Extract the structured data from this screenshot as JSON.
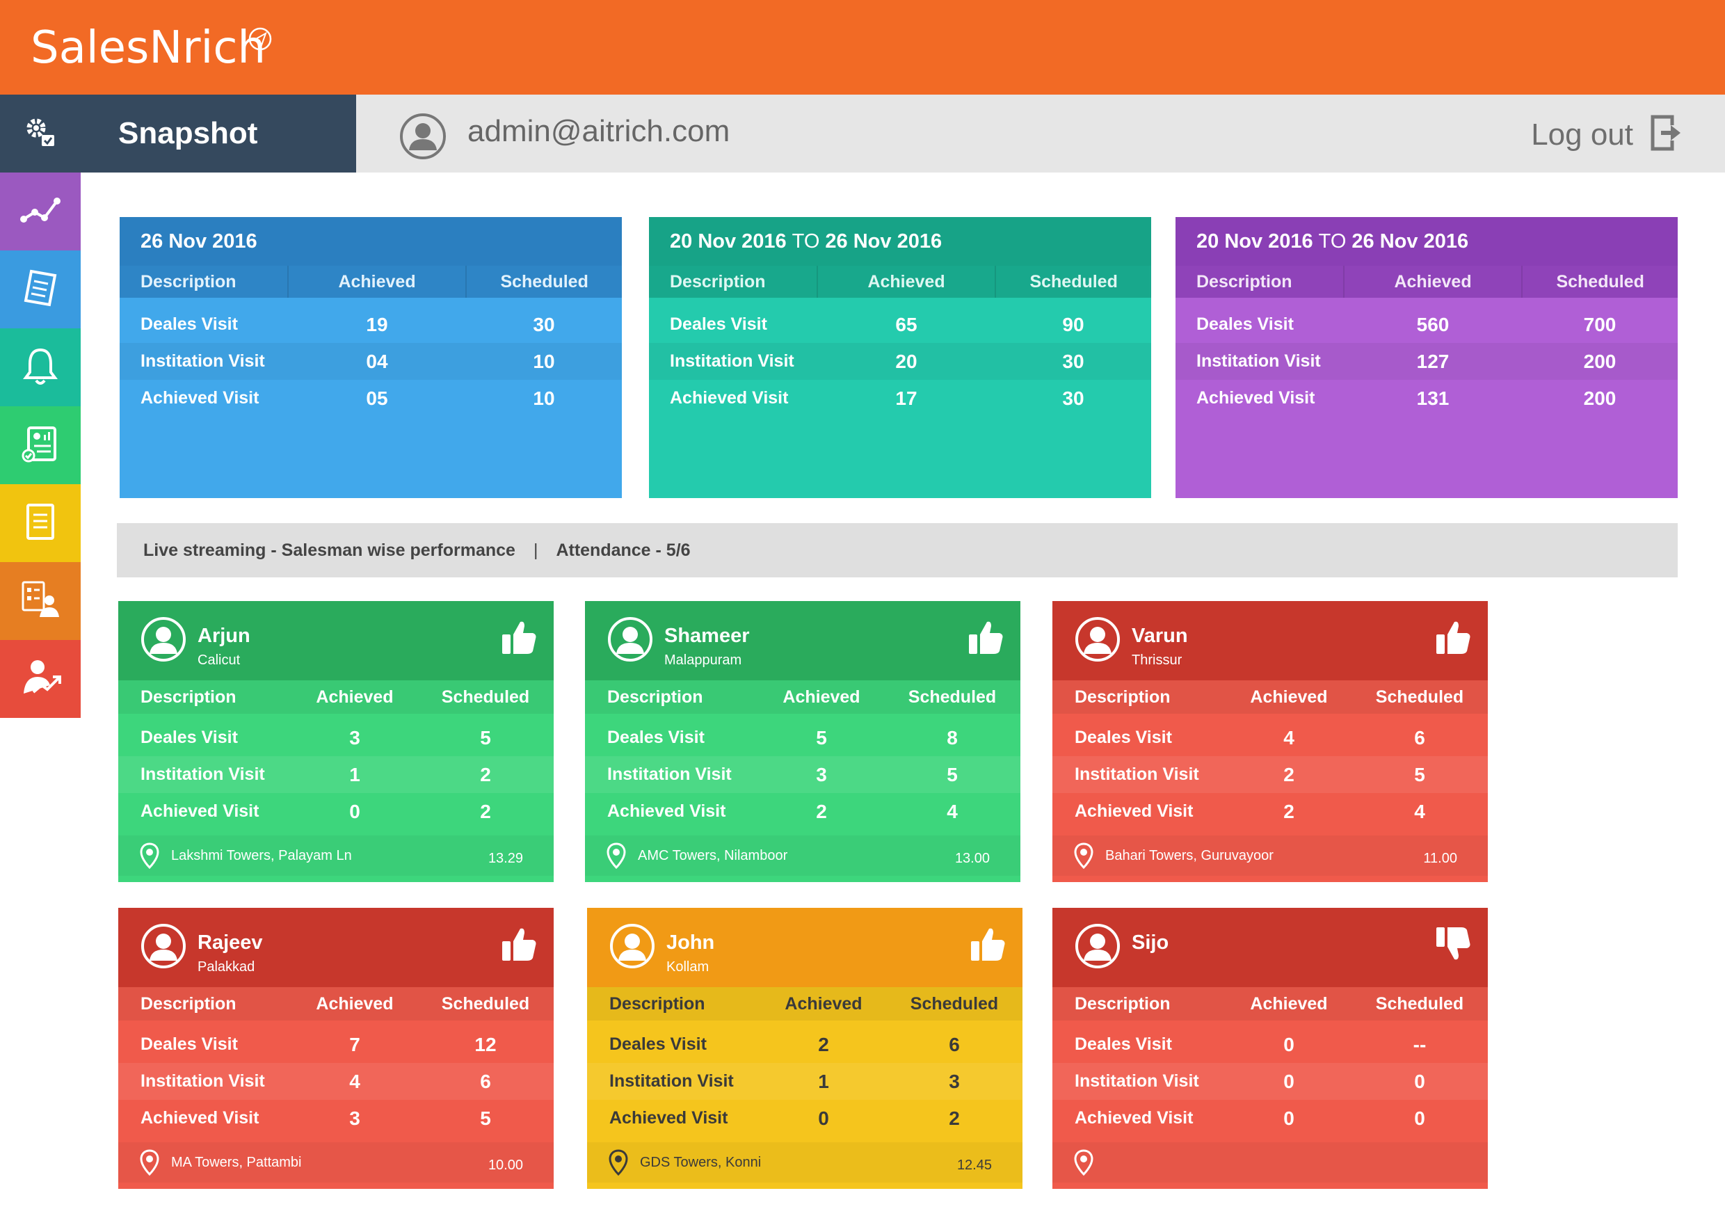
{
  "app": {
    "logo_text": "SalesNrich",
    "logo_icon": "paper-plane-icon"
  },
  "colors": {
    "topbar": "#f26a25",
    "snapshot_tab": "#35495e",
    "header_bg": "#e6e6e6",
    "blue": "#41a8eb",
    "blue_dark": "#2b7fc0",
    "teal": "#24cbad",
    "teal_dark": "#17a387",
    "purple": "#b05fd6",
    "purple_dark": "#8a3fb5",
    "green": "#3dd67c",
    "green_dark": "#2aab5c",
    "red": "#f05a4b",
    "red_dark": "#c7372c",
    "yellow": "#f5c51d",
    "yellow_dark": "#f19a15"
  },
  "sidebar": {
    "items": [
      {
        "icon": "settings-gear-icon",
        "color": "#35495e"
      },
      {
        "icon": "analytics-graph-icon",
        "color": "#9b59c0"
      },
      {
        "icon": "checklist-icon",
        "color": "#3a9be0"
      },
      {
        "icon": "bell-notification-icon",
        "color": "#1bbc9b"
      },
      {
        "icon": "report-document-icon",
        "color": "#2ecc71"
      },
      {
        "icon": "document-icon",
        "color": "#f1c40f"
      },
      {
        "icon": "user-form-icon",
        "color": "#e67e22"
      },
      {
        "icon": "user-growth-icon",
        "color": "#e74c3c"
      }
    ]
  },
  "header": {
    "tab_label": "Snapshot",
    "user_icon": "user-avatar-icon",
    "user_email": "admin@aitrich.com",
    "logout_label": "Log out",
    "logout_icon": "logout-icon"
  },
  "summary": [
    {
      "date_a": "26 Nov 2016",
      "to": "",
      "date_b": "",
      "cols": [
        "Description",
        "Achieved",
        "Scheduled"
      ],
      "rows": [
        {
          "desc": "Deales Visit",
          "achieved": "19",
          "scheduled": "30"
        },
        {
          "desc": "Institation Visit",
          "achieved": "04",
          "scheduled": "10"
        },
        {
          "desc": "Achieved Visit",
          "achieved": "05",
          "scheduled": "10"
        }
      ]
    },
    {
      "date_a": "20 Nov 2016",
      "to": "TO",
      "date_b": "26 Nov 2016",
      "cols": [
        "Description",
        "Achieved",
        "Scheduled"
      ],
      "rows": [
        {
          "desc": "Deales Visit",
          "achieved": "65",
          "scheduled": "90"
        },
        {
          "desc": "Institation Visit",
          "achieved": "20",
          "scheduled": "30"
        },
        {
          "desc": "Achieved Visit",
          "achieved": "17",
          "scheduled": "30"
        }
      ]
    },
    {
      "date_a": "20 Nov 2016",
      "to": "TO",
      "date_b": "26 Nov 2016",
      "cols": [
        "Description",
        "Achieved",
        "Scheduled"
      ],
      "rows": [
        {
          "desc": "Deales Visit",
          "achieved": "560",
          "scheduled": "700"
        },
        {
          "desc": "Institation Visit",
          "achieved": "127",
          "scheduled": "200"
        },
        {
          "desc": "Achieved Visit",
          "achieved": "131",
          "scheduled": "200"
        }
      ]
    }
  ],
  "live": {
    "title": "Live streaming - Salesman wise performance",
    "separator": "|",
    "attendance": "Attendance - 5/6"
  },
  "salesmen": [
    {
      "name": "Arjun",
      "location": "Calicut",
      "thumb": "thumbs-up",
      "cols": [
        "Description",
        "Achieved",
        "Scheduled"
      ],
      "rows": [
        {
          "desc": "Deales Visit",
          "achieved": "3",
          "scheduled": "5"
        },
        {
          "desc": "Institation Visit",
          "achieved": "1",
          "scheduled": "2"
        },
        {
          "desc": "Achieved Visit",
          "achieved": "0",
          "scheduled": "2"
        }
      ],
      "address": "Lakshmi Towers, Palayam Ln",
      "time": "13.29"
    },
    {
      "name": "Shameer",
      "location": "Malappuram",
      "thumb": "thumbs-up",
      "cols": [
        "Description",
        "Achieved",
        "Scheduled"
      ],
      "rows": [
        {
          "desc": "Deales Visit",
          "achieved": "5",
          "scheduled": "8"
        },
        {
          "desc": "Institation Visit",
          "achieved": "3",
          "scheduled": "5"
        },
        {
          "desc": "Achieved Visit",
          "achieved": "2",
          "scheduled": "4"
        }
      ],
      "address": "AMC Towers, Nilamboor",
      "time": "13.00"
    },
    {
      "name": "Varun",
      "location": "Thrissur",
      "thumb": "thumbs-up",
      "cols": [
        "Description",
        "Achieved",
        "Scheduled"
      ],
      "rows": [
        {
          "desc": "Deales Visit",
          "achieved": "4",
          "scheduled": "6"
        },
        {
          "desc": "Institation Visit",
          "achieved": "2",
          "scheduled": "5"
        },
        {
          "desc": "Achieved Visit",
          "achieved": "2",
          "scheduled": "4"
        }
      ],
      "address": "Bahari Towers, Guruvayoor",
      "time": "11.00"
    },
    {
      "name": "Rajeev",
      "location": "Palakkad",
      "thumb": "thumbs-up",
      "cols": [
        "Description",
        "Achieved",
        "Scheduled"
      ],
      "rows": [
        {
          "desc": "Deales Visit",
          "achieved": "7",
          "scheduled": "12"
        },
        {
          "desc": "Institation Visit",
          "achieved": "4",
          "scheduled": "6"
        },
        {
          "desc": "Achieved Visit",
          "achieved": "3",
          "scheduled": "5"
        }
      ],
      "address": "MA Towers, Pattambi",
      "time": "10.00"
    },
    {
      "name": "John",
      "location": "Kollam",
      "thumb": "thumbs-up",
      "cols": [
        "Description",
        "Achieved",
        "Scheduled"
      ],
      "rows": [
        {
          "desc": "Deales Visit",
          "achieved": "2",
          "scheduled": "6"
        },
        {
          "desc": "Institation Visit",
          "achieved": "1",
          "scheduled": "3"
        },
        {
          "desc": "Achieved Visit",
          "achieved": "0",
          "scheduled": "2"
        }
      ],
      "address": "GDS Towers, Konni",
      "time": "12.45"
    },
    {
      "name": "Sijo",
      "location": "",
      "thumb": "thumbs-down",
      "cols": [
        "Description",
        "Achieved",
        "Scheduled"
      ],
      "rows": [
        {
          "desc": "Deales Visit",
          "achieved": "0",
          "scheduled": "--"
        },
        {
          "desc": "Institation Visit",
          "achieved": "0",
          "scheduled": "0"
        },
        {
          "desc": "Achieved Visit",
          "achieved": "0",
          "scheduled": "0"
        }
      ],
      "address": "",
      "time": ""
    }
  ]
}
